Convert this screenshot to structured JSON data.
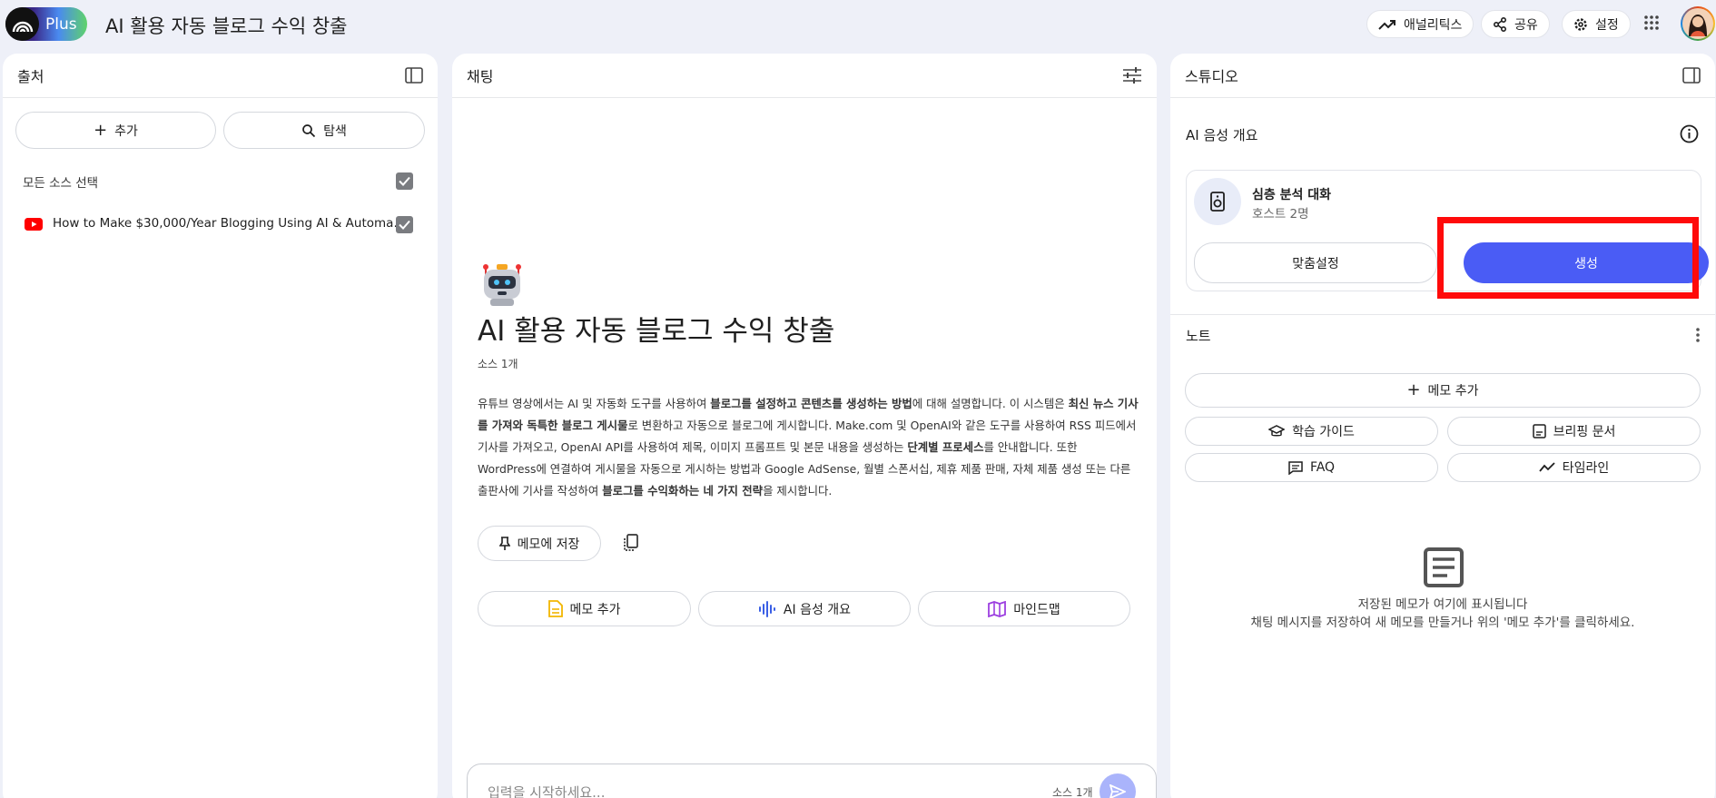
{
  "header": {
    "logo_text": "Plus",
    "title": "AI 활용 자동 블로그 수익 창출",
    "analytics_label": "애널리틱스",
    "share_label": "공유",
    "settings_label": "설정"
  },
  "sources": {
    "title": "출처",
    "add_label": "추가",
    "explore_label": "탐색",
    "select_all_label": "모든 소스 선택",
    "items": [
      {
        "title": "How to Make $30,000/Year Blogging Using AI & Automa..."
      }
    ]
  },
  "chat": {
    "title": "채팅",
    "notebook_title": "AI 활용 자동 블로그 수익 창출",
    "source_count": "소스 1개",
    "summary_parts": [
      "유튜브 영상에서는 AI 및 자동화 도구를 사용하여 ",
      "블로그를 설정하고 콘텐츠를 생성하는 방법",
      "에 대해 설명합니다. 이 시스템은 ",
      "최신 뉴스 기사를 가져와 독특한 블로그 게시물",
      "로 변환하고 자동으로 블로그에 게시합니다. Make.com 및 OpenAI와 같은 도구를 사용하여 RSS 피드에서 기사를 가져오고, OpenAI API를 사용하여 제목, 이미지 프롬프트 및 본문 내용을 생성하는 ",
      "단계별 프로세스",
      "를 안내합니다. 또한 WordPress에 연결하여 게시물을 자동으로 게시하는 방법과 Google AdSense, 월별 스폰서십, 제휴 제품 판매, 자체 제품 생성 또는 다른 출판사에 기사를 작성하여 ",
      "블로그를 수익화하는 네 가지 전략",
      "을 제시합니다."
    ],
    "save_to_note_label": "메모에 저장",
    "actions": [
      {
        "label": "메모 추가",
        "color": "#f2b600"
      },
      {
        "label": "AI 음성 개요",
        "color": "#3a5fe5"
      },
      {
        "label": "마인드맵",
        "color": "#9c3fe0"
      }
    ],
    "input_placeholder": "입력을 시작하세요...",
    "input_source_count": "소스 1개"
  },
  "studio": {
    "title": "스튜디오",
    "audio_overview_title": "AI 음성 개요",
    "card_title": "심층 분석 대화",
    "card_subtitle": "호스트 2명",
    "customize_label": "맞춤설정",
    "generate_label": "생성",
    "notes_title": "노트",
    "add_note_label": "메모 추가",
    "note_buttons": [
      {
        "label": "학습 가이드"
      },
      {
        "label": "브리핑 문서"
      },
      {
        "label": "FAQ"
      },
      {
        "label": "타임라인"
      }
    ],
    "empty_title": "저장된 메모가 여기에 표시됩니다",
    "empty_desc": "채팅 메시지를 저장하여 새 메모를 만들거나 위의 '메모 추가'를 클릭하세요."
  },
  "colors": {
    "accent": "#4a5cf5",
    "highlight": "#ff0a0a",
    "youtube": "#ff0000"
  }
}
